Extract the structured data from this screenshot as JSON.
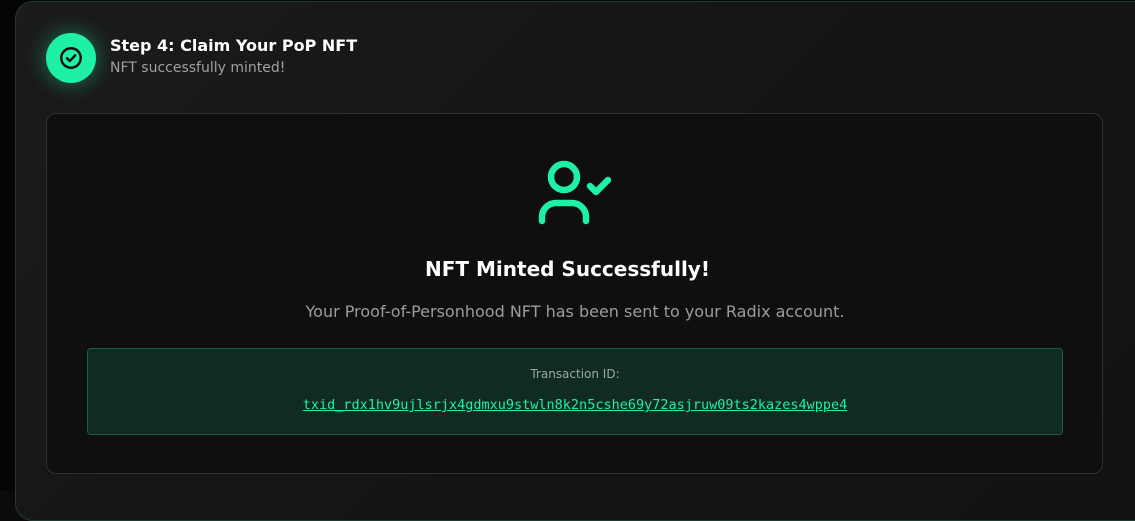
{
  "colors": {
    "accent": "#1ef0a6",
    "card_bg": "#161616",
    "panel_bg": "#0f0f0f",
    "tx_box_bg": "#0f2b23",
    "text_primary": "#ffffff",
    "text_muted": "#9c9c9c"
  },
  "step": {
    "icon": "check-circle-icon",
    "title": "Step 4: Claim Your PoP NFT",
    "subtitle": "NFT successfully minted!"
  },
  "result": {
    "icon": "user-check-icon",
    "title": "NFT Minted Successfully!",
    "description": "Your Proof-of-Personhood NFT has been sent to your Radix account."
  },
  "transaction": {
    "label": "Transaction ID:",
    "id": "txid_rdx1hv9ujlsrjx4gdmxu9stwln8k2n5cshe69y72asjruw09ts2kazes4wppe4"
  }
}
